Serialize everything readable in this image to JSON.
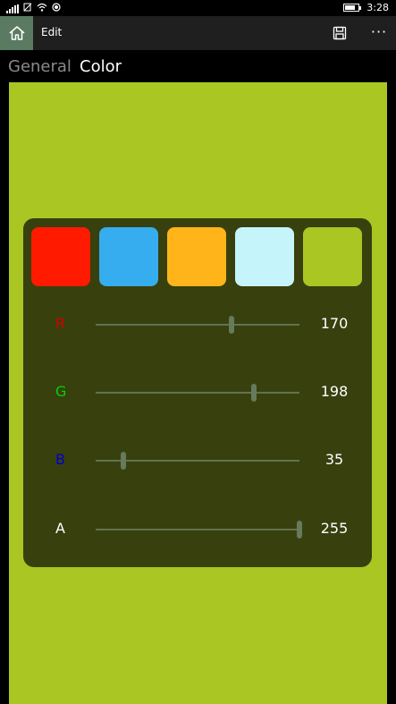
{
  "status": {
    "time": "3:28"
  },
  "appbar": {
    "title": "Edit"
  },
  "tabs": [
    {
      "label": "General",
      "active": false
    },
    {
      "label": "Color",
      "active": true
    }
  ],
  "colors": {
    "background": "#a9c623",
    "card": "#38400e",
    "accent": "#5b7a62"
  },
  "swatches": [
    {
      "color": "#ff1a00"
    },
    {
      "color": "#35adef"
    },
    {
      "color": "#ffb519"
    },
    {
      "color": "#c5f5fa"
    },
    {
      "color": "#a9c623"
    }
  ],
  "channels": [
    {
      "label": "R",
      "value": "170",
      "max": 255,
      "color": "#d40000"
    },
    {
      "label": "G",
      "value": "198",
      "max": 255,
      "color": "#00d400"
    },
    {
      "label": "B",
      "value": "35",
      "max": 255,
      "color": "#0000c8"
    },
    {
      "label": "A",
      "value": "255",
      "max": 255,
      "color": "#ffffff"
    }
  ],
  "icons": {
    "home": "home-icon",
    "save": "save-icon",
    "more": "more-icon"
  }
}
